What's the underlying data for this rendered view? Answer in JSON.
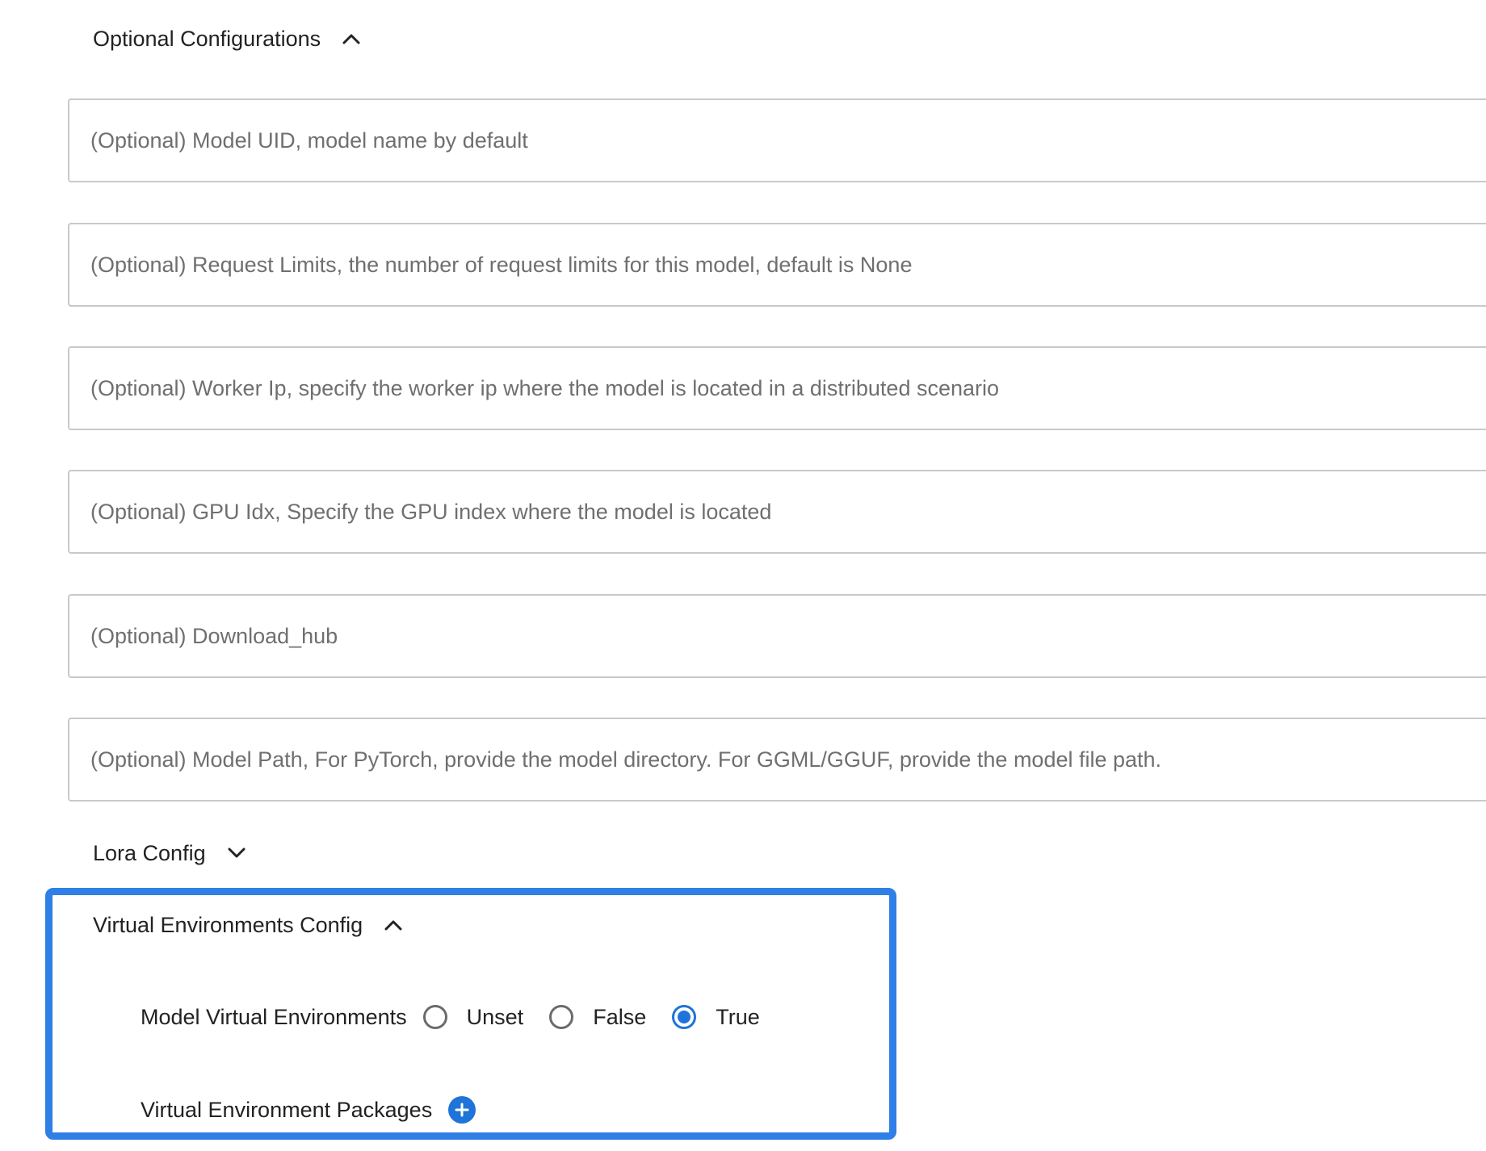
{
  "optional_configurations": {
    "title": "Optional Configurations",
    "expanded": true,
    "fields": [
      {
        "placeholder": "(Optional) Model UID, model name by default",
        "value": ""
      },
      {
        "placeholder": "(Optional) Request Limits, the number of request limits for this model, default is None",
        "value": ""
      },
      {
        "placeholder": "(Optional) Worker Ip, specify the worker ip where the model is located in a distributed scenario",
        "value": ""
      },
      {
        "placeholder": "(Optional) GPU Idx, Specify the GPU index where the model is located",
        "value": ""
      },
      {
        "placeholder": "(Optional) Download_hub",
        "value": ""
      },
      {
        "placeholder": "(Optional) Model Path, For PyTorch, provide the model directory. For GGML/GGUF, provide the model file path.",
        "value": ""
      }
    ]
  },
  "lora_config": {
    "title": "Lora Config",
    "expanded": false
  },
  "virtual_env_config": {
    "title": "Virtual Environments Config",
    "expanded": true,
    "model_virtual_environments": {
      "label": "Model Virtual Environments",
      "options": [
        "Unset",
        "False",
        "True"
      ],
      "selected": "True"
    },
    "packages": {
      "label": "Virtual Environment Packages"
    }
  },
  "colors": {
    "accent": "#1e74d8",
    "highlight_border": "#2f7fe6",
    "field_border": "#c9c9c9"
  }
}
